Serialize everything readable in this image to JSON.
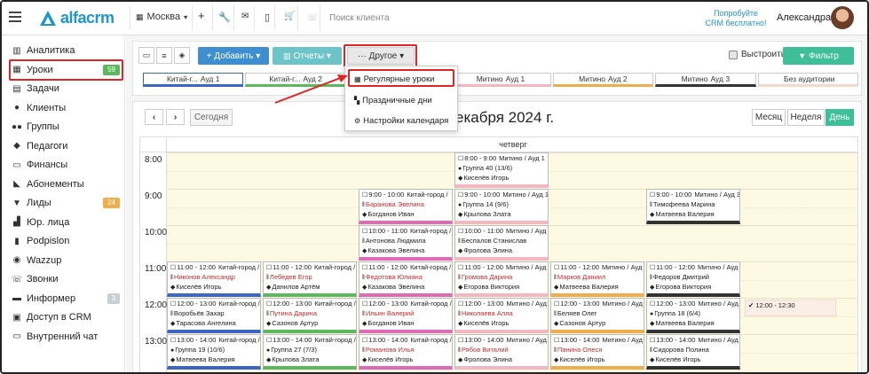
{
  "app": {
    "logo_text": "alfacrm"
  },
  "topbar": {
    "branch": "Москва",
    "search_placeholder": "Поиск клиента",
    "promo": "Попробуйте CRM бесплатно!",
    "user": "Александра"
  },
  "sidebar": {
    "items": [
      {
        "label": "Аналитика",
        "icon": "chart-icon"
      },
      {
        "label": "Уроки",
        "icon": "calendar-icon",
        "badge": "59",
        "badge_color": "#5cb85c"
      },
      {
        "label": "Задачи",
        "icon": "tasks-icon"
      },
      {
        "label": "Клиенты",
        "icon": "user-icon"
      },
      {
        "label": "Группы",
        "icon": "users-icon"
      },
      {
        "label": "Педагоги",
        "icon": "teacher-icon"
      },
      {
        "label": "Финансы",
        "icon": "money-icon"
      },
      {
        "label": "Абонементы",
        "icon": "tag-icon"
      },
      {
        "label": "Лиды",
        "icon": "funnel-icon",
        "badge": "24",
        "badge_color": "#f0ad4e"
      },
      {
        "label": "Юр. лица",
        "icon": "building-icon"
      },
      {
        "label": "Podpislon",
        "icon": "doc-icon"
      },
      {
        "label": "Wazzup",
        "icon": "whatsapp-icon"
      },
      {
        "label": "Звонки",
        "icon": "phone-icon"
      },
      {
        "label": "Информер",
        "icon": "mail-icon",
        "badge": "3",
        "badge_color": "#c9cfd6"
      },
      {
        "label": "Доступ в CRM",
        "icon": "lock-icon"
      },
      {
        "label": "Внутренний чат",
        "icon": "chat-icon"
      }
    ]
  },
  "toolbar": {
    "add": "+ Добавить ▾",
    "reports": "Отчеты ▾",
    "other": "··· Другое ▾",
    "highlight_label": "Выстроить",
    "filter": "Фильтр"
  },
  "rooms": [
    {
      "a": "Китай-г...",
      "b": "Ауд 1",
      "color": "#3a66c4"
    },
    {
      "a": "Китай-г...",
      "b": "Ауд 2",
      "color": "#5cb85c"
    },
    {
      "a": "Китай-город",
      "b": "Ауд 3",
      "color": "#e06bb5"
    },
    {
      "a": "Митино",
      "b": "Ауд 1",
      "color": "#f4b6c2"
    },
    {
      "a": "Митино",
      "b": "Ауд 2",
      "color": "#f0ad4e"
    },
    {
      "a": "Митино",
      "b": "Ауд 3",
      "color": "#333333"
    },
    {
      "a": "",
      "b": "Без аудитории",
      "color": "#f3d9ca"
    }
  ],
  "dropdown": {
    "items": [
      "Регулярные уроки",
      "Праздничные дни",
      "Настройки календаря"
    ]
  },
  "calendar": {
    "today": "Сегодня",
    "title": "екабря 2024 г.",
    "views": [
      "Месяц",
      "Неделя",
      "День"
    ],
    "day": "четверг",
    "times": [
      "8:00",
      "9:00",
      "10:00",
      "11:00",
      "12:00",
      "13:00"
    ]
  },
  "events": [
    {
      "col": 3,
      "row": 0,
      "time": "8:00 - 9:00",
      "place": "Митино / Ауд 1",
      "l2": "Группа 40 (13/6)",
      "l2red": false,
      "l3": "Киселёв Игорь",
      "color": "#f4b6c2"
    },
    {
      "col": 2,
      "row": 1,
      "time": "9:00 - 10:00",
      "place": "Китай-город /",
      "l2": "Баранова Эвелина",
      "l2red": true,
      "l3": "Богданов Иван",
      "color": "#e06bb5"
    },
    {
      "col": 3,
      "row": 1,
      "time": "9:00 - 10:00",
      "place": "Митино / Ауд 1",
      "l2": "Группа 14 (9/6)",
      "l2red": false,
      "l3": "Крылова Злата",
      "color": "#f4b6c2"
    },
    {
      "col": 5,
      "row": 1,
      "time": "9:00 - 10:00",
      "place": "Митино / Ауд 3",
      "l2": "Тимофеева Марина",
      "l2red": false,
      "l3": "Матвеева Валерия",
      "color": "#333333"
    },
    {
      "col": 2,
      "row": 2,
      "time": "10:00 - 11:00",
      "place": "Китай-город /",
      "l2": "Антонова Людмила",
      "l2red": false,
      "l3": "Казакова Эвелина",
      "color": "#e06bb5"
    },
    {
      "col": 3,
      "row": 2,
      "time": "10:00 - 11:00",
      "place": "Митино / Ауд 1",
      "l2": "Беспалов Станислав",
      "l2red": false,
      "l3": "Фролова Элина",
      "color": "#f4b6c2"
    },
    {
      "col": 0,
      "row": 3,
      "time": "11:00 - 12:00",
      "place": "Китай-город /",
      "l2": "Никонов Александр",
      "l2red": true,
      "l3": "Киселёв Игорь",
      "color": "#3a66c4"
    },
    {
      "col": 1,
      "row": 3,
      "time": "11:00 - 12:00",
      "place": "Китай-город /",
      "l2": "Лебедев Егор",
      "l2red": true,
      "l3": "Данилов Артём",
      "color": "#5cb85c"
    },
    {
      "col": 2,
      "row": 3,
      "time": "11:00 - 12:00",
      "place": "Китай-город /",
      "l2": "Федотова Юлиана",
      "l2red": true,
      "l3": "Казакова Эвелина",
      "color": "#e06bb5"
    },
    {
      "col": 3,
      "row": 3,
      "time": "11:00 - 12:00",
      "place": "Митино / Ауд 1",
      "l2": "Громова Дарина",
      "l2red": true,
      "l3": "Егорова Виктория",
      "color": "#f4b6c2"
    },
    {
      "col": 4,
      "row": 3,
      "time": "11:00 - 12:00",
      "place": "Митино / Ауд",
      "l2": "Марков Даниил",
      "l2red": true,
      "l3": "Матвеева Валерия",
      "color": "#f0ad4e"
    },
    {
      "col": 5,
      "row": 3,
      "time": "11:00 - 12:00",
      "place": "Митино / Ауд",
      "l2": "Федоров Дмитрий",
      "l2red": false,
      "l3": "Егорова Виктория",
      "color": "#333333"
    },
    {
      "col": 0,
      "row": 4,
      "time": "12:00 - 13:00",
      "place": "Китай-город /",
      "l2": "Воробьёв Захар",
      "l2red": false,
      "l3": "Тарасова Ангелина",
      "color": "#3a66c4"
    },
    {
      "col": 1,
      "row": 4,
      "time": "12:00 - 13:00",
      "place": "Китай-город /",
      "l2": "Путина Дарина",
      "l2red": true,
      "l3": "Сазонов Артур",
      "color": "#5cb85c"
    },
    {
      "col": 2,
      "row": 4,
      "time": "12:00 - 13:00",
      "place": "Китай-город /",
      "l2": "Ильин Валерий",
      "l2red": true,
      "l3": "Богданов Иван",
      "color": "#e06bb5"
    },
    {
      "col": 3,
      "row": 4,
      "time": "12:00 - 13:00",
      "place": "Митино / Ауд 1",
      "l2": "Николаева Алла",
      "l2red": true,
      "l3": "Киселёв Игорь",
      "color": "#f4b6c2"
    },
    {
      "col": 4,
      "row": 4,
      "time": "12:00 - 13:00",
      "place": "Митино / Ауд",
      "l2": "Беляев Олег",
      "l2red": false,
      "l3": "Сазонов Артур",
      "color": "#f0ad4e"
    },
    {
      "col": 5,
      "row": 4,
      "time": "12:00 - 13:00",
      "place": "Митино / Ауд",
      "l2": "Группа 18 (6/4)",
      "l2red": false,
      "l3": "Матвеева Валерия",
      "color": "#333333"
    },
    {
      "col": 0,
      "row": 5,
      "time": "13:00 - 14:00",
      "place": "Китай-город /",
      "l2": "Группа 19 (10/6)",
      "l2red": false,
      "l3": "Матвеева Валерия",
      "color": "#3a66c4"
    },
    {
      "col": 1,
      "row": 5,
      "time": "13:00 - 14:00",
      "place": "Китай-город /",
      "l2": "Группа 27 (7/3)",
      "l2red": false,
      "l3": "Крылова Злата",
      "color": "#5cb85c"
    },
    {
      "col": 2,
      "row": 5,
      "time": "13:00 - 14:00",
      "place": "Китай-город /",
      "l2": "Романова Илья",
      "l2red": true,
      "l3": "Киселёв Игорь",
      "color": "#e06bb5"
    },
    {
      "col": 3,
      "row": 5,
      "time": "13:00 - 14:00",
      "place": "Митино / Ауд 1",
      "l2": "Рябов Виталий",
      "l2red": true,
      "l3": "Фролова Элина",
      "color": "#f4b6c2"
    },
    {
      "col": 4,
      "row": 5,
      "time": "13:00 - 14:00",
      "place": "Митино / Ауд",
      "l2": "Панина Олеся",
      "l2red": true,
      "l3": "Киселёв Игорь",
      "color": "#f0ad4e"
    },
    {
      "col": 5,
      "row": 5,
      "time": "13:00 - 14:00",
      "place": "Митино / Ауд",
      "l2": "Сидорова Полина",
      "l2red": false,
      "l3": "Киселёв Игорь",
      "color": "#333333"
    }
  ],
  "unassigned_event": {
    "time": "12:00 - 12:30"
  }
}
